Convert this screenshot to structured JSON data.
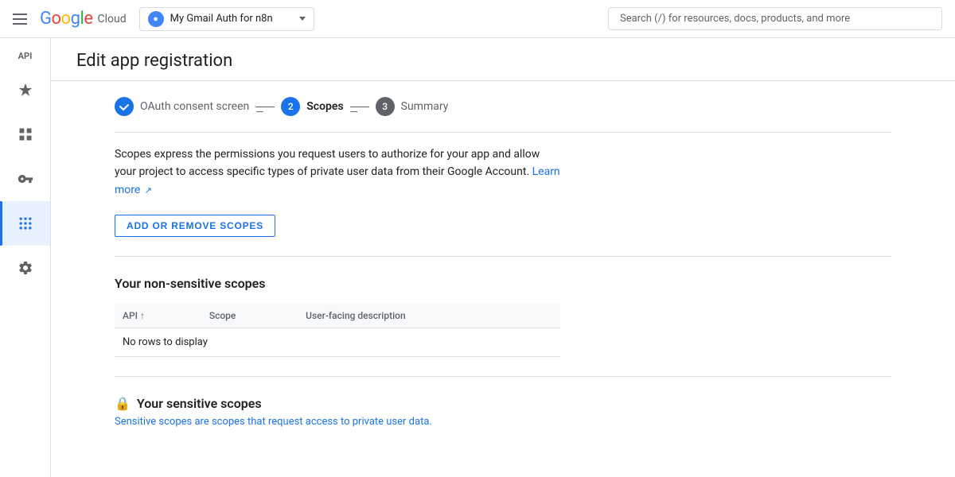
{
  "header": {
    "menu_icon": "hamburger-icon",
    "logo_text": "Google Cloud",
    "project_selector": {
      "icon": "project-icon",
      "name": "My Gmail Auth for n8n",
      "chevron": "chevron-down-icon"
    },
    "search_placeholder": "Search (/) for resources, docs, products, and more"
  },
  "sidebar": {
    "api_badge": "API",
    "items": [
      {
        "id": "dashboard",
        "icon": "sparkle-icon"
      },
      {
        "id": "services",
        "icon": "grid-icon"
      },
      {
        "id": "credentials",
        "icon": "key-icon"
      },
      {
        "id": "oauth",
        "icon": "dots-icon",
        "active": true
      },
      {
        "id": "settings",
        "icon": "settings-icon"
      }
    ]
  },
  "page": {
    "title": "Edit app registration",
    "stepper": {
      "steps": [
        {
          "id": "oauth-consent",
          "label": "OAuth consent screen",
          "status": "done",
          "number": "1"
        },
        {
          "id": "scopes",
          "label": "Scopes",
          "status": "active",
          "number": "2"
        },
        {
          "id": "summary",
          "label": "Summary",
          "status": "inactive",
          "number": "3"
        }
      ],
      "separator": "—"
    },
    "description": {
      "text_before_link": "Scopes express the permissions you request users to authorize for your app and allow your project to access specific types of private user data from their Google Account.",
      "link_text": "Learn more",
      "external_icon": "external-link-icon"
    },
    "add_scopes_button": "ADD OR REMOVE SCOPES",
    "sections": [
      {
        "id": "non-sensitive",
        "title": "Your non-sensitive scopes",
        "table": {
          "columns": [
            {
              "id": "api",
              "label": "API",
              "sortable": true
            },
            {
              "id": "scope",
              "label": "Scope"
            },
            {
              "id": "description",
              "label": "User-facing description"
            }
          ],
          "empty_message": "No rows to display"
        }
      },
      {
        "id": "sensitive",
        "title": "Your sensitive scopes",
        "subtitle": "Sensitive scopes are scopes that request access to private user data."
      }
    ]
  }
}
